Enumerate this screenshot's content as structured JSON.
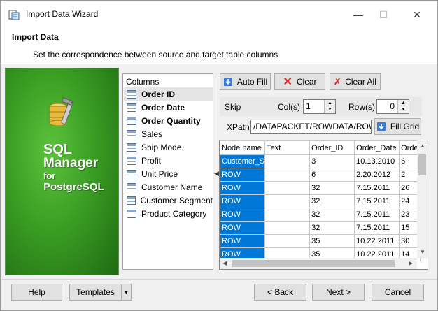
{
  "window": {
    "title": "Import Data Wizard",
    "minimize_glyph": "—",
    "maximize_glyph": "☐",
    "close_glyph": "✕"
  },
  "header": {
    "title": "Import Data",
    "subtitle": "Set the correspondence between source and target table columns"
  },
  "banner": {
    "line1": "SQL",
    "line2": "Manager",
    "line3": "for",
    "line4": "PostgreSQL"
  },
  "columns": {
    "header": "Columns",
    "items": [
      {
        "label": "Order ID",
        "bold": true,
        "selected": true
      },
      {
        "label": "Order Date",
        "bold": true
      },
      {
        "label": "Order Quantity",
        "bold": true
      },
      {
        "label": "Sales"
      },
      {
        "label": "Ship Mode"
      },
      {
        "label": "Profit"
      },
      {
        "label": "Unit Price"
      },
      {
        "label": "Customer Name"
      },
      {
        "label": "Customer Segment"
      },
      {
        "label": "Product Category"
      }
    ]
  },
  "toolbar": {
    "auto_fill": "Auto Fill",
    "clear": "Clear",
    "clear_all": "Clear All"
  },
  "skip": {
    "label": "Skip",
    "cols_label": "Col(s)",
    "cols_value": "1",
    "rows_label": "Row(s)",
    "rows_value": "0"
  },
  "xpath": {
    "label": "XPath",
    "value": "/DATAPACKET/ROWDATA/ROW/",
    "fill_grid": "Fill Grid"
  },
  "grid": {
    "headers": [
      "Node name",
      "Text",
      "Order_ID",
      "Order_Date",
      "Orde"
    ],
    "rows": [
      [
        "Customer_S",
        "",
        "3",
        "10.13.2010",
        "6"
      ],
      [
        "ROW",
        "",
        "6",
        "2.20.2012",
        "2"
      ],
      [
        "ROW",
        "",
        "32",
        "7.15.2011",
        "26"
      ],
      [
        "ROW",
        "",
        "32",
        "7.15.2011",
        "24"
      ],
      [
        "ROW",
        "",
        "32",
        "7.15.2011",
        "23"
      ],
      [
        "ROW",
        "",
        "32",
        "7.15.2011",
        "15"
      ],
      [
        "ROW",
        "",
        "35",
        "10.22.2011",
        "30"
      ],
      [
        "ROW",
        "",
        "35",
        "10.22.2011",
        "14"
      ]
    ]
  },
  "footer": {
    "help": "Help",
    "templates": "Templates",
    "back": "< Back",
    "next": "Next >",
    "cancel": "Cancel"
  },
  "colors": {
    "selection": "#0078d7",
    "banner_green": "#3a9e23"
  }
}
